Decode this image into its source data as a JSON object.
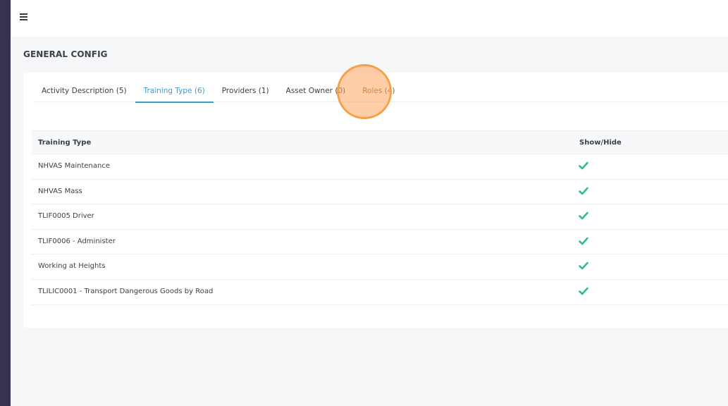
{
  "header": {
    "menu_icon": "hamburger-icon"
  },
  "page": {
    "title": "GENERAL CONFIG"
  },
  "tabs": [
    {
      "label": "Activity Description (5)",
      "active": false
    },
    {
      "label": "Training Type (6)",
      "active": true
    },
    {
      "label": "Providers (1)",
      "active": false
    },
    {
      "label": "Asset Owner (0)",
      "active": false
    },
    {
      "label": "Roles (4)",
      "active": false
    }
  ],
  "table": {
    "columns": [
      "Training Type",
      "Show/Hide"
    ],
    "rows": [
      {
        "name": "NHVAS Maintenance",
        "visible": true
      },
      {
        "name": "NHVAS Mass",
        "visible": true
      },
      {
        "name": "TLIF0005 Driver",
        "visible": true
      },
      {
        "name": "TLIF0006 - Administer",
        "visible": true
      },
      {
        "name": "Working at Heights",
        "visible": true
      },
      {
        "name": "TLILIC0001 - Transport Dangerous Goods by Road",
        "visible": true
      }
    ],
    "check_icon": "check-icon"
  },
  "colors": {
    "sidebar": "#36334f",
    "accent": "#3d9bd0",
    "check": "#2fbf86",
    "marker": "#f5a04a"
  }
}
